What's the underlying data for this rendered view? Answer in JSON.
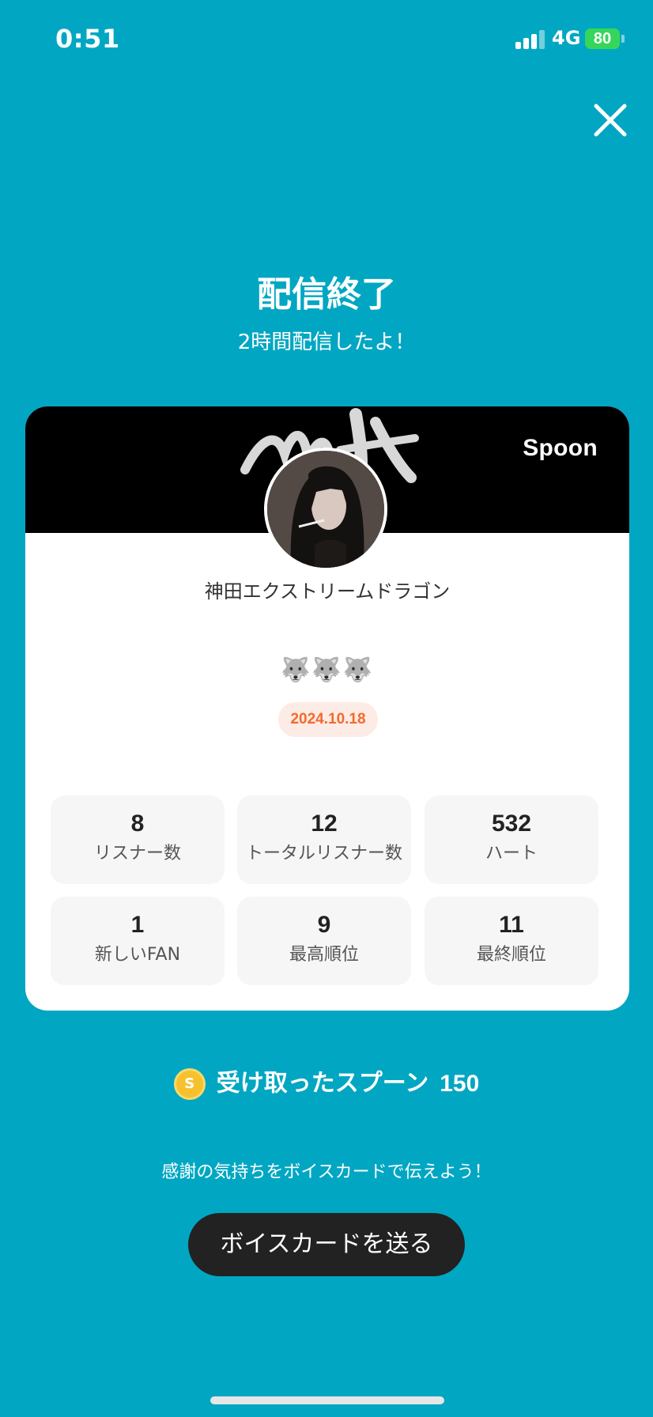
{
  "status_bar": {
    "time": "0:51",
    "network": "4G",
    "battery": "80"
  },
  "header": {
    "title": "配信終了",
    "subtitle": "2時間配信したよ！"
  },
  "card": {
    "brand": "Spoon",
    "username": "神田エクストリームドラゴン",
    "emojis": "🐺🐺🐺",
    "date": "2024.10.18",
    "stats": [
      {
        "value": "8",
        "label": "リスナー数"
      },
      {
        "value": "12",
        "label": "トータルリスナー数"
      },
      {
        "value": "532",
        "label": "ハート"
      },
      {
        "value": "1",
        "label": "新しいFAN"
      },
      {
        "value": "9",
        "label": "最高順位"
      },
      {
        "value": "11",
        "label": "最終順位"
      }
    ]
  },
  "spoons": {
    "icon": "coin-icon",
    "coin_letter": "S",
    "label": "受け取ったスプーン",
    "count": "150"
  },
  "thanks_text": "感謝の気持ちをボイスカードで伝えよう！",
  "voice_card_button": "ボイスカードを送る",
  "colors": {
    "background": "#01A7C2",
    "date_text": "#F26A2E",
    "button": "#222222"
  }
}
